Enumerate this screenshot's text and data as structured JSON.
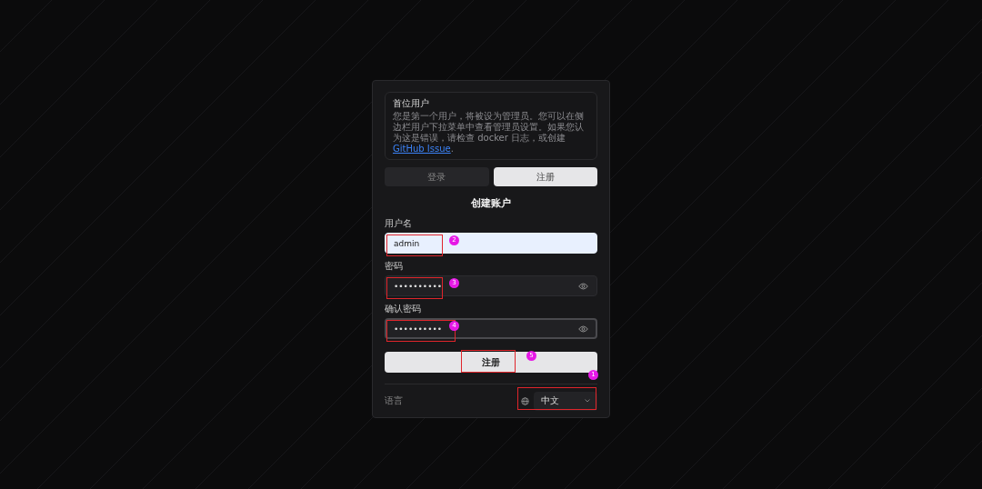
{
  "notice": {
    "title": "首位用户",
    "body": "您是第一个用户，将被设为管理员。您可以在侧边栏用户下拉菜单中查看管理员设置。如果您认为这是错误，请检查 docker 日志，或创建 ",
    "link": "GitHub Issue",
    "end": "."
  },
  "tabs": [
    {
      "label": "登录",
      "selected": false
    },
    {
      "label": "注册",
      "selected": true
    }
  ],
  "heading": "创建账户",
  "fields": [
    {
      "label": "用户名",
      "value": "admin",
      "kind": "text",
      "focused": false,
      "autofilled": true,
      "marker": "2"
    },
    {
      "label": "密码",
      "value": "••••••••••",
      "kind": "password",
      "focused": false,
      "autofilled": false,
      "marker": "3"
    },
    {
      "label": "确认密码",
      "value": "••••••••••",
      "kind": "password",
      "focused": true,
      "autofilled": false,
      "marker": "4"
    }
  ],
  "submit": {
    "label": "注册",
    "marker": "5"
  },
  "language": {
    "label": "语言",
    "value": "中文",
    "marker": "1"
  }
}
